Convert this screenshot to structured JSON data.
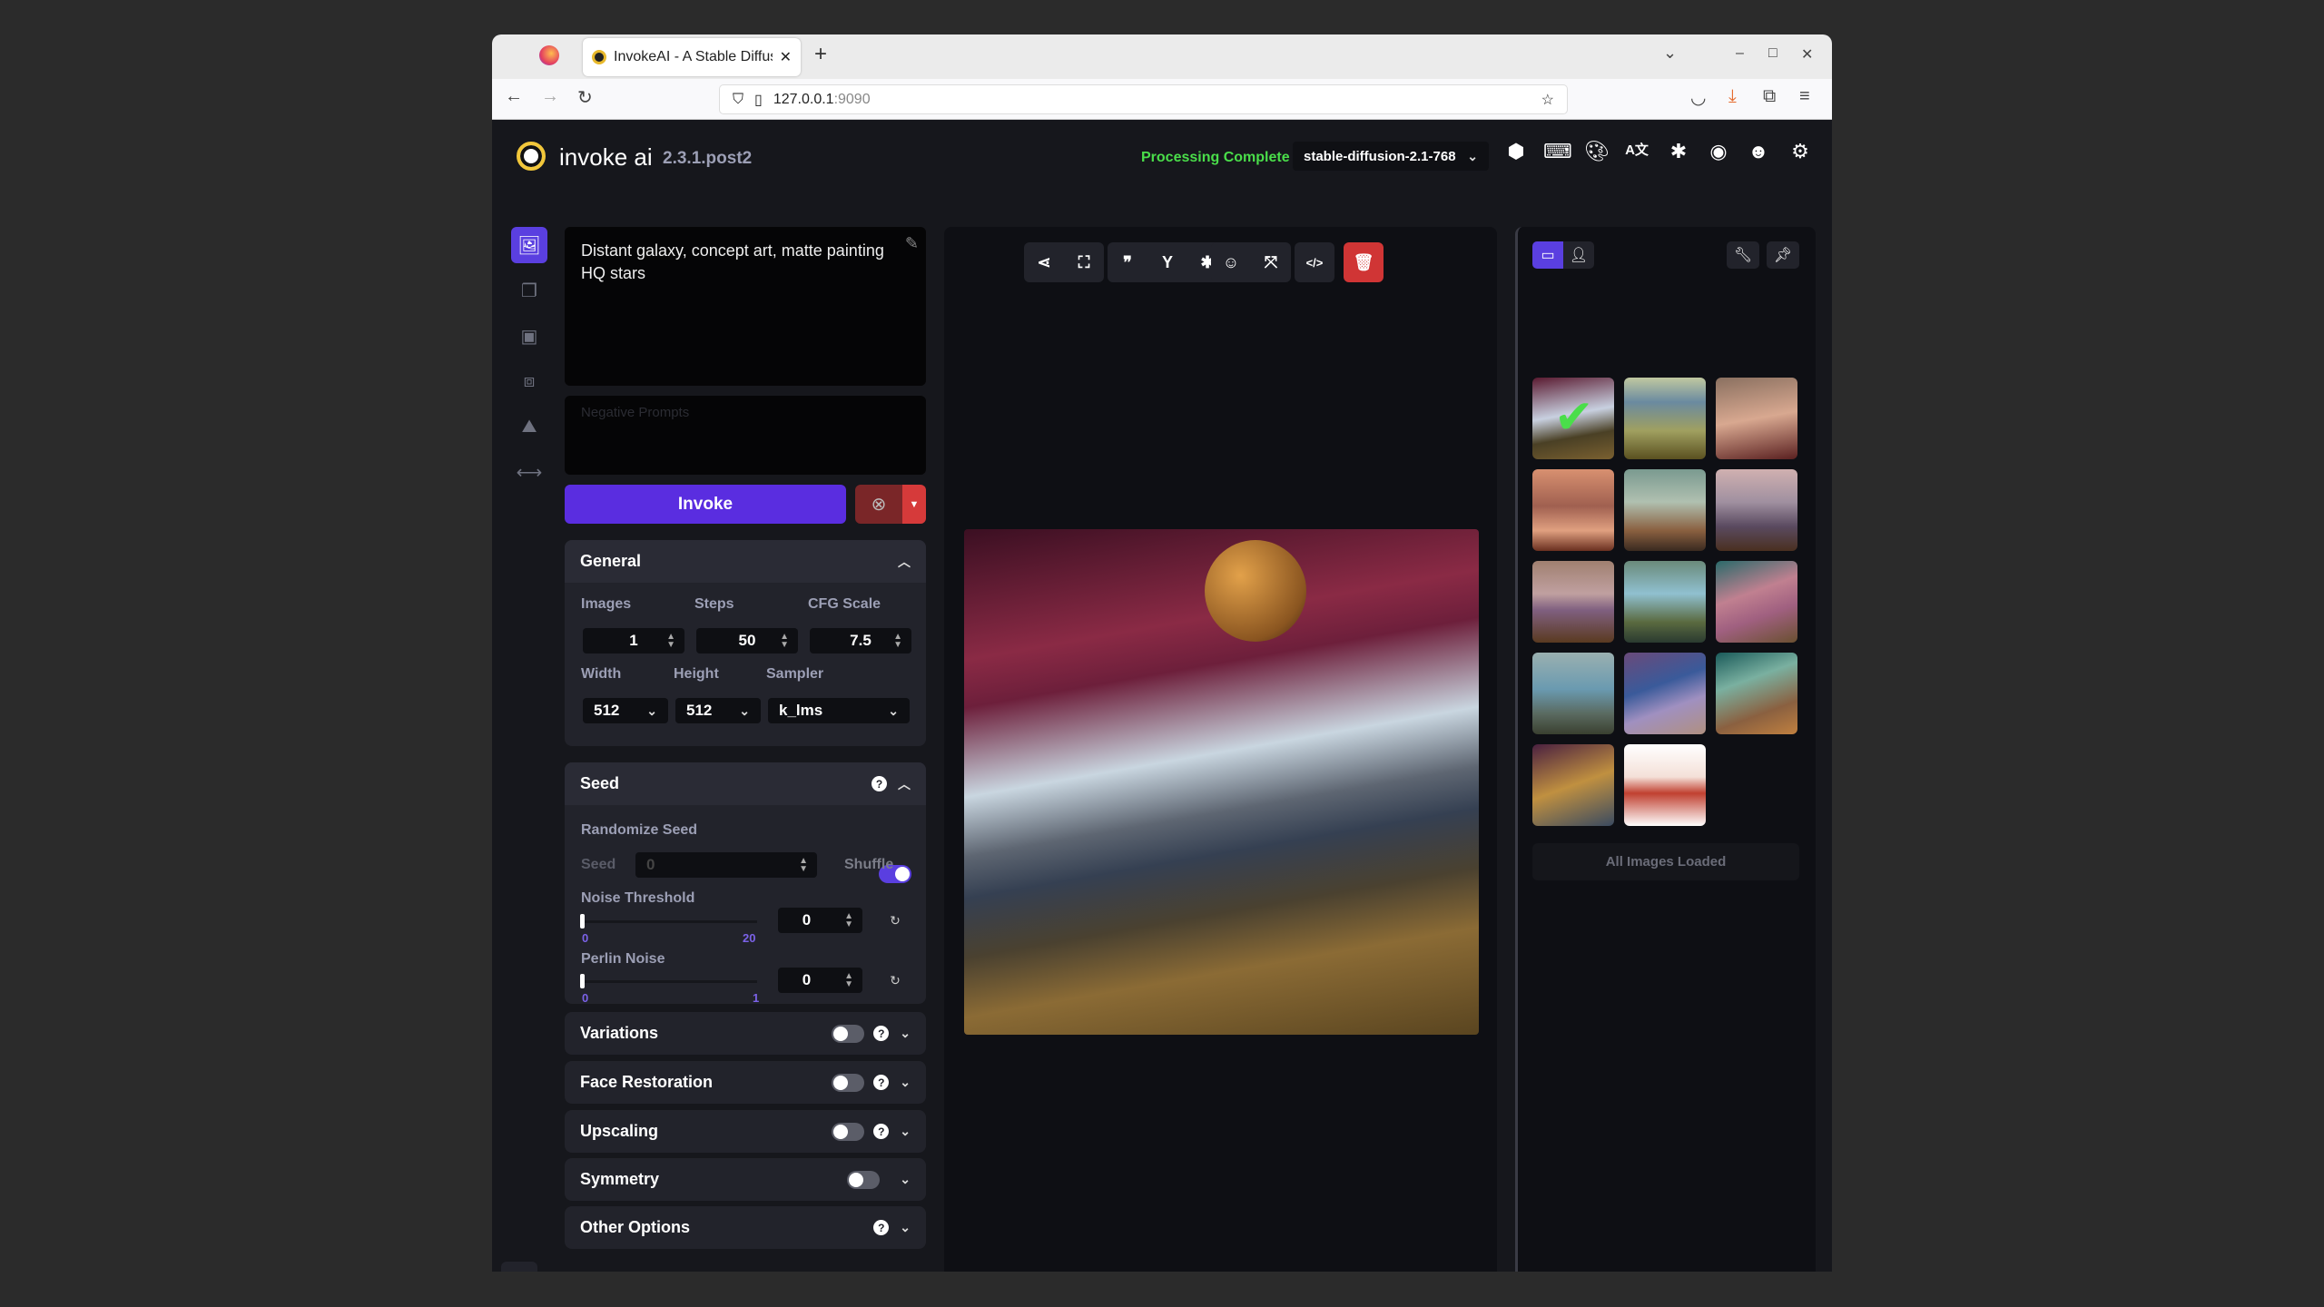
{
  "browser": {
    "tab_title": "InvokeAI - A Stable Diffus",
    "url_host": "127.0.0.1",
    "url_port": ":9090"
  },
  "header": {
    "brand": "invoke ai",
    "version": "2.3.1.post2",
    "status": "Processing Complete",
    "status_color": "#4ade4a",
    "model": "stable-diffusion-2.1-768",
    "icons": [
      "model-manager-icon",
      "hotkeys-icon",
      "theme-icon",
      "language-icon",
      "bug-icon",
      "github-icon",
      "discord-icon",
      "settings-icon"
    ]
  },
  "sidebar": {
    "tabs": [
      "text-to-image",
      "image-to-image",
      "unified-canvas",
      "nodes",
      "postprocessing",
      "training"
    ]
  },
  "prompt": {
    "value": "Distant galaxy, concept art, matte painting HQ stars",
    "negative_placeholder": "Negative Prompts"
  },
  "invoke": {
    "label": "Invoke",
    "accent": "#5a2de0"
  },
  "general": {
    "title": "General",
    "images_label": "Images",
    "images": "1",
    "steps_label": "Steps",
    "steps": "50",
    "cfg_label": "CFG Scale",
    "cfg": "7.5",
    "width_label": "Width",
    "width": "512",
    "height_label": "Height",
    "height": "512",
    "sampler_label": "Sampler",
    "sampler": "k_lms"
  },
  "seed": {
    "title": "Seed",
    "randomize_label": "Randomize Seed",
    "randomize_on": true,
    "seed_label": "Seed",
    "seed_value": "0",
    "shuffle": "Shuffle",
    "noise_label": "Noise Threshold",
    "noise_min": "0",
    "noise_max": "20",
    "noise_value": "0",
    "perlin_label": "Perlin Noise",
    "perlin_min": "0",
    "perlin_max": "1",
    "perlin_value": "0"
  },
  "sections": [
    {
      "title": "Variations",
      "toggle": true,
      "help": true
    },
    {
      "title": "Face Restoration",
      "toggle": true,
      "help": true
    },
    {
      "title": "Upscaling",
      "toggle": true,
      "help": true
    },
    {
      "title": "Symmetry",
      "toggle": true,
      "help": false
    },
    {
      "title": "Other Options",
      "toggle": false,
      "help": true
    }
  ],
  "gallery": {
    "footer": "All Images Loaded",
    "count": 14
  }
}
